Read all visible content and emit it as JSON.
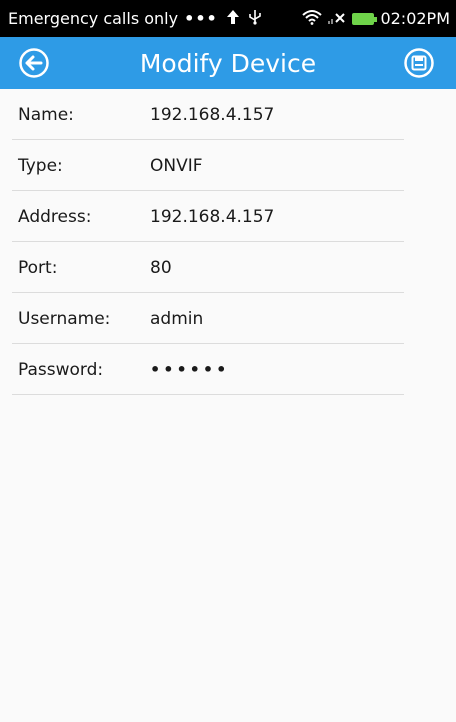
{
  "status_bar": {
    "carrier_text": "Emergency calls only",
    "dots": "•••",
    "time": "02:02PM",
    "icons": [
      "upload-arrow-icon",
      "usb-icon",
      "wifi-icon",
      "signal-icon",
      "battery-icon"
    ],
    "battery_color": "#6fd34a"
  },
  "app_bar": {
    "title": "Modify Device",
    "color": "#2e9be6",
    "back_icon": "back-arrow-icon",
    "save_icon": "save-icon"
  },
  "form": {
    "name": {
      "label": "Name:",
      "value": "192.168.4.157"
    },
    "type": {
      "label": "Type:",
      "value": "ONVIF"
    },
    "address": {
      "label": "Address:",
      "value": "192.168.4.157"
    },
    "port": {
      "label": "Port:",
      "value": "80"
    },
    "username": {
      "label": "Username:",
      "value": "admin"
    },
    "password": {
      "label": "Password:",
      "value": "••••••"
    }
  }
}
